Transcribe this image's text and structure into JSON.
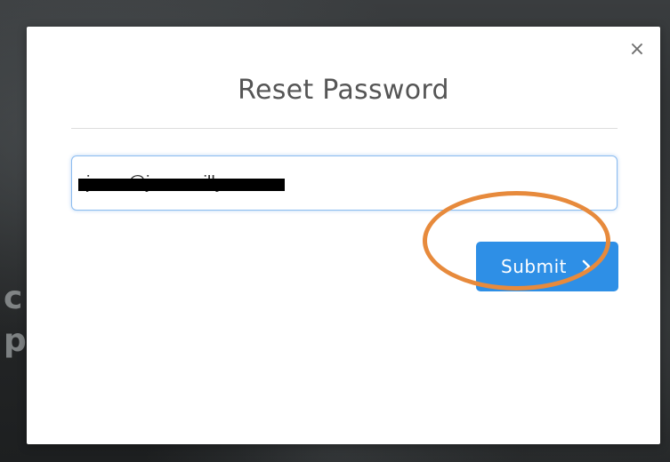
{
  "background": {
    "fragment_1": "c",
    "fragment_2": "p"
  },
  "modal": {
    "title": "Reset Password",
    "close_icon": "close-icon",
    "close_glyph": "×",
    "email": {
      "value": "jesse@jessereilly.com",
      "redacted": true
    },
    "submit": {
      "label": "Submit",
      "icon": "chevron-right-icon"
    }
  },
  "annotation": {
    "highlight_color": "#e78a3c"
  },
  "colors": {
    "primary_button": "#2e8fe6",
    "input_focus_border": "#8bbcf0"
  }
}
